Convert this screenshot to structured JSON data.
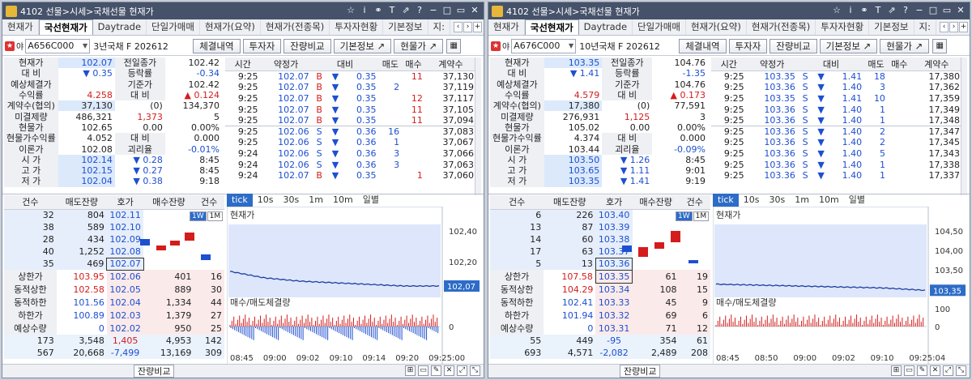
{
  "windows": [
    {
      "title": "4102 선물>시세>국채선물 현재가",
      "tabs": [
        "현재가",
        "국선현재가",
        "Daytrade",
        "단일가매매",
        "현재가(요약)",
        "현재가(전종목)",
        "투자자현황",
        "기본정보",
        "지:"
      ],
      "active_tab": 1,
      "code": "A656C000",
      "code_name": "3년국채 F 202612",
      "buttons": [
        "체결내역",
        "투자자",
        "잔량비교",
        "기본정보 ↗",
        "현물가 ↗"
      ],
      "info_rows": [
        [
          "현재가",
          "102.07",
          "전일종가",
          "102.42"
        ],
        [
          "대 비",
          "▼ 0.35",
          "등락률",
          "-0.34"
        ],
        [
          "예상체결가",
          "",
          "기준가",
          "102.42"
        ],
        [
          "수익률",
          "4.258",
          "대 비",
          "▲ 0.124"
        ],
        [
          "계약수(협의)",
          "37,130",
          "(0)",
          "134,370"
        ],
        [
          "미결제량",
          "486,321",
          "1,373",
          "5"
        ],
        [
          "현물가",
          "102.65",
          "0.00",
          "0.00%"
        ],
        [
          "현물가수익률",
          "4.052",
          "대 비",
          "0.000"
        ],
        [
          "이론가",
          "102.08",
          "괴리율",
          "-0.01%"
        ],
        [
          "시 가",
          "102.14",
          "▼ 0.28",
          "8:45"
        ],
        [
          "고 가",
          "102.15",
          "▼ 0.27",
          "8:45"
        ],
        [
          "저 가",
          "102.04",
          "▼ 0.38",
          "9:18"
        ]
      ],
      "trade_headers": [
        "시간",
        "약정가",
        "대비",
        "매도",
        "매수",
        "계약수"
      ],
      "trades": [
        [
          "9:25",
          "102.07",
          "B",
          "▼",
          "0.35",
          "",
          "11",
          "37,130"
        ],
        [
          "9:25",
          "102.07",
          "B",
          "▼",
          "0.35",
          "2",
          "",
          "37,119"
        ],
        [
          "9:25",
          "102.07",
          "B",
          "▼",
          "0.35",
          "",
          "12",
          "37,117"
        ],
        [
          "9:25",
          "102.07",
          "B",
          "▼",
          "0.35",
          "",
          "11",
          "37,105"
        ],
        [
          "9:25",
          "102.07",
          "B",
          "▼",
          "0.35",
          "",
          "11",
          "37,094"
        ],
        [
          "9:25",
          "102.06",
          "S",
          "▼",
          "0.36",
          "16",
          "",
          "37,083"
        ],
        [
          "9:25",
          "102.06",
          "S",
          "▼",
          "0.36",
          "1",
          "",
          "37,067"
        ],
        [
          "9:24",
          "102.06",
          "S",
          "▼",
          "0.36",
          "3",
          "",
          "37,066"
        ],
        [
          "9:24",
          "102.06",
          "S",
          "▼",
          "0.36",
          "3",
          "",
          "37,063"
        ],
        [
          "9:24",
          "102.07",
          "B",
          "▼",
          "0.35",
          "",
          "1",
          "37,060"
        ]
      ],
      "ob_headers": [
        "건수",
        "매도잔량",
        "호가",
        "매수잔량",
        "건수"
      ],
      "ob_sell": [
        [
          "32",
          "804",
          "102.11"
        ],
        [
          "38",
          "589",
          "102.10"
        ],
        [
          "28",
          "434",
          "102.09"
        ],
        [
          "40",
          "1,252",
          "102.08"
        ],
        [
          "35",
          "469",
          "102.07"
        ]
      ],
      "ob_buy": [
        [
          "상한가",
          "103.95",
          "102.06",
          "401",
          "16"
        ],
        [
          "동적상한",
          "102.58",
          "102.05",
          "889",
          "30"
        ],
        [
          "동적하한",
          "101.56",
          "102.04",
          "1,334",
          "44"
        ],
        [
          "하한가",
          "100.89",
          "102.03",
          "1,379",
          "27"
        ],
        [
          "예상수량",
          "0",
          "102.02",
          "950",
          "25"
        ]
      ],
      "ob_total": [
        [
          "173",
          "3,548",
          "1,405",
          "4,953",
          "142"
        ],
        [
          "567",
          "20,668",
          "-7,499",
          "13,169",
          "309"
        ]
      ],
      "bottom_label": "잔량비교",
      "chart_tabs": [
        "tick",
        "10s",
        "30s",
        "1m",
        "10m",
        "일별"
      ],
      "chart_title": "현재가",
      "chart2_title": "매수/매도체결량",
      "y_ticks": [
        "102,40",
        "102,20"
      ],
      "current_price_tag": "102,07",
      "zero_tick": "0",
      "x_ticks": [
        "08:45",
        "09:00",
        "09:02",
        "09:10",
        "09:14",
        "09:20",
        "09:25:00"
      ],
      "chart_data": {
        "type": "line",
        "x": [
          "08:45",
          "09:00",
          "09:02",
          "09:10",
          "09:14",
          "09:20",
          "09:25"
        ],
        "values": [
          102.16,
          102.12,
          102.1,
          102.09,
          102.08,
          102.07,
          102.07
        ],
        "ylim": [
          102.0,
          102.45
        ]
      }
    },
    {
      "title": "4102 선물>시세>국채선물 현재가",
      "tabs": [
        "현재가",
        "국선현재가",
        "Daytrade",
        "단일가매매",
        "현재가(요약)",
        "현재가(전종목)",
        "투자자현황",
        "기본정보",
        "지:"
      ],
      "active_tab": 1,
      "code": "A676C000",
      "code_name": "10년국채 F 202612",
      "buttons": [
        "체결내역",
        "투자자",
        "잔량비교",
        "기본정보 ↗",
        "현물가 ↗"
      ],
      "info_rows": [
        [
          "현재가",
          "103.35",
          "전일종가",
          "104.76"
        ],
        [
          "대 비",
          "▼ 1.41",
          "등락률",
          "-1.35"
        ],
        [
          "예상체결가",
          "",
          "기준가",
          "104.76"
        ],
        [
          "수익률",
          "4.579",
          "대 비",
          "▲ 0.173"
        ],
        [
          "계약수(협의)",
          "17,380",
          "(0)",
          "77,591"
        ],
        [
          "미결제량",
          "276,931",
          "1,125",
          "3"
        ],
        [
          "현물가",
          "105.02",
          "0.00",
          "0.00%"
        ],
        [
          "현물가수익률",
          "4.374",
          "대 비",
          "0.000"
        ],
        [
          "이론가",
          "103.44",
          "괴리율",
          "-0.09%"
        ],
        [
          "시 가",
          "103.50",
          "▼ 1.26",
          "8:45"
        ],
        [
          "고 가",
          "103.65",
          "▼ 1.11",
          "9:01"
        ],
        [
          "저 가",
          "103.35",
          "▼ 1.41",
          "9:19"
        ]
      ],
      "trade_headers": [
        "시간",
        "약정가",
        "대비",
        "매도",
        "매수",
        "계약수"
      ],
      "trades": [
        [
          "9:25",
          "103.35",
          "S",
          "▼",
          "1.41",
          "18",
          "",
          "17,380"
        ],
        [
          "9:25",
          "103.36",
          "S",
          "▼",
          "1.40",
          "3",
          "",
          "17,362"
        ],
        [
          "9:25",
          "103.35",
          "S",
          "▼",
          "1.41",
          "10",
          "",
          "17,359"
        ],
        [
          "9:25",
          "103.36",
          "S",
          "▼",
          "1.40",
          "1",
          "",
          "17,349"
        ],
        [
          "9:25",
          "103.36",
          "S",
          "▼",
          "1.40",
          "1",
          "",
          "17,348"
        ],
        [
          "9:25",
          "103.36",
          "S",
          "▼",
          "1.40",
          "2",
          "",
          "17,347"
        ],
        [
          "9:25",
          "103.36",
          "S",
          "▼",
          "1.40",
          "2",
          "",
          "17,345"
        ],
        [
          "9:25",
          "103.36",
          "S",
          "▼",
          "1.40",
          "5",
          "",
          "17,343"
        ],
        [
          "9:25",
          "103.36",
          "S",
          "▼",
          "1.40",
          "1",
          "",
          "17,338"
        ],
        [
          "9:25",
          "103.36",
          "S",
          "▼",
          "1.40",
          "1",
          "",
          "17,337"
        ]
      ],
      "ob_headers": [
        "건수",
        "매도잔량",
        "호가",
        "매수잔량",
        "건수"
      ],
      "ob_sell": [
        [
          "6",
          "226",
          "103.40"
        ],
        [
          "13",
          "87",
          "103.39"
        ],
        [
          "14",
          "60",
          "103.38"
        ],
        [
          "17",
          "63",
          "103.37"
        ],
        [
          "5",
          "13",
          "103.36"
        ]
      ],
      "ob_buy": [
        [
          "상한가",
          "107.58",
          "103.35",
          "61",
          "19"
        ],
        [
          "동적상한",
          "104.29",
          "103.34",
          "108",
          "15"
        ],
        [
          "동적하한",
          "102.41",
          "103.33",
          "45",
          "9"
        ],
        [
          "하한가",
          "101.94",
          "103.32",
          "69",
          "6"
        ],
        [
          "예상수량",
          "0",
          "103.31",
          "71",
          "12"
        ]
      ],
      "ob_total": [
        [
          "55",
          "449",
          "-95",
          "354",
          "61"
        ],
        [
          "693",
          "4,571",
          "-2,082",
          "2,489",
          "208"
        ]
      ],
      "bottom_label": "잔량비교",
      "chart_tabs": [
        "tick",
        "10s",
        "30s",
        "1m",
        "10m",
        "일별"
      ],
      "chart_title": "현재가",
      "chart2_title": "매수/매도체결량",
      "y_ticks": [
        "104,50",
        "104,00",
        "103,50"
      ],
      "current_price_tag": "103,35",
      "zero_tick": "0",
      "y2_ticks": [
        "100"
      ],
      "x_ticks": [
        "08:45",
        "08:50",
        "09:00",
        "09:02",
        "09:10",
        "09:25:04"
      ],
      "chart_data": {
        "type": "line",
        "x": [
          "08:45",
          "08:50",
          "09:00",
          "09:02",
          "09:10",
          "09:25"
        ],
        "values": [
          103.48,
          103.46,
          103.44,
          103.42,
          103.4,
          103.35
        ],
        "ylim": [
          103.2,
          104.75
        ]
      }
    }
  ]
}
